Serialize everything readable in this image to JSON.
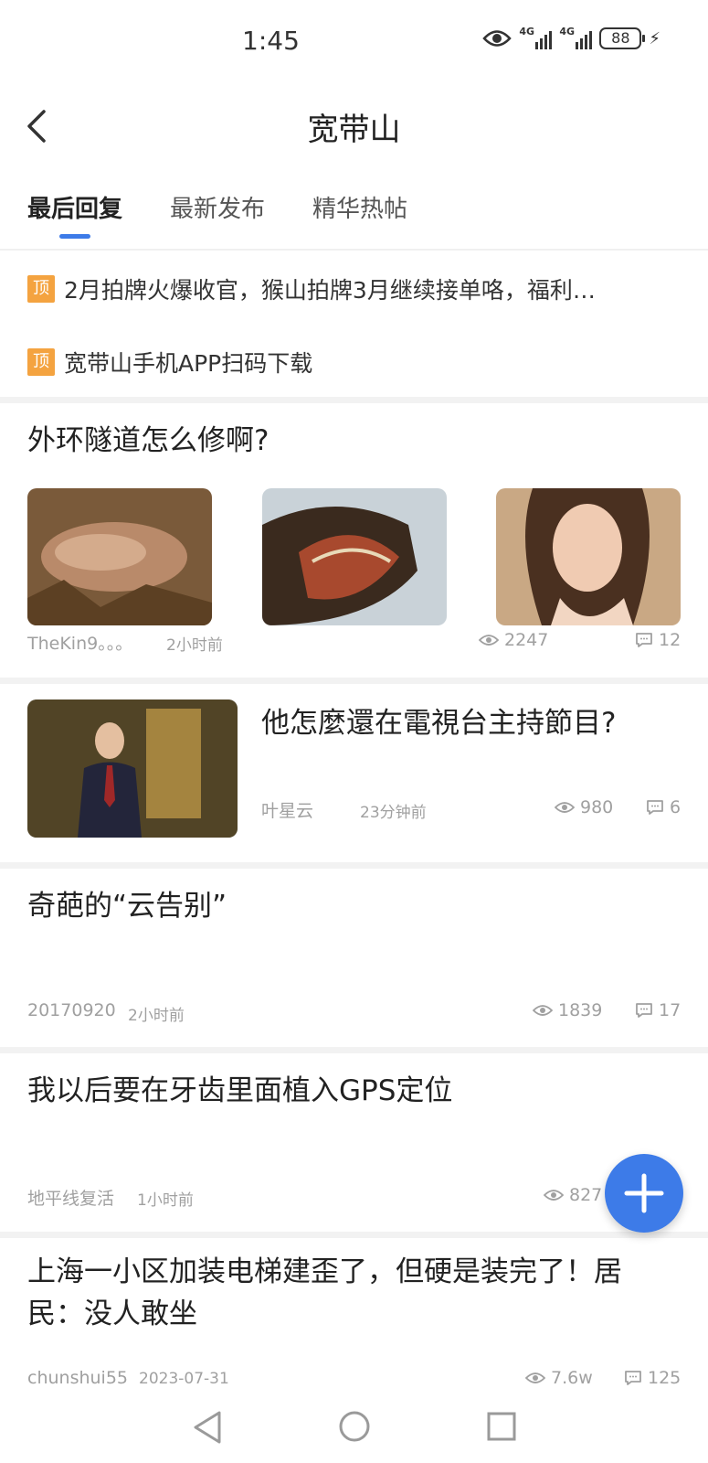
{
  "status": {
    "time": "1:45",
    "network1": "4G",
    "network2": "4G",
    "battery": "88"
  },
  "nav": {
    "title": "宽带山"
  },
  "tabs": [
    {
      "label": "最后回复"
    },
    {
      "label": "最新发布"
    },
    {
      "label": "精华热帖"
    }
  ],
  "pinned": [
    {
      "badge": "顶",
      "text": "2月拍牌火爆收官，猴山拍牌3月继续接单咯，福利…"
    },
    {
      "badge": "顶",
      "text": "宽带山手机APP扫码下载"
    }
  ],
  "posts": [
    {
      "title": "外环隧道怎么修啊?",
      "author": "TheKin9。。。",
      "time": "2小时前",
      "views": "2247",
      "comments": "12"
    },
    {
      "title": "他怎麼還在電視台主持節目?",
      "author": "叶星云",
      "time": "23分钟前",
      "views": "980",
      "comments": "6"
    },
    {
      "title": "奇葩的“云告别”",
      "author": "20170920",
      "time": "2小时前",
      "views": "1839",
      "comments": "17"
    },
    {
      "title": "我以后要在牙齿里面植入GPS定位",
      "author": "地平线复活",
      "time": "1小时前",
      "views": "827"
    },
    {
      "title": "上海一小区加装电梯建歪了，但硬是装完了！居民：没人敢坐",
      "author": "chunshui55",
      "time": "2023-07-31",
      "views": "7.6w",
      "comments": "125"
    }
  ],
  "colors": {
    "accent": "#3d7be8",
    "pin": "#f4a340"
  }
}
